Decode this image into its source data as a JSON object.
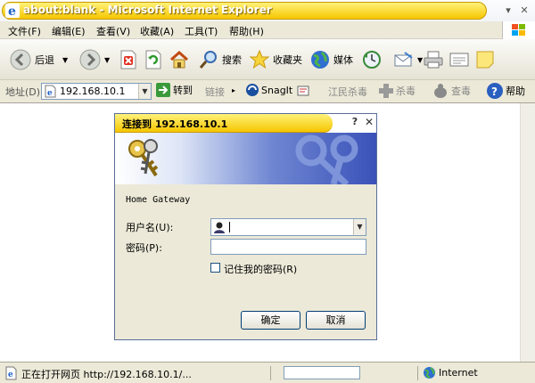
{
  "window": {
    "title": "about:blank - Microsoft Internet Explorer",
    "minimize_glyph": "▾",
    "close_glyph": "✕"
  },
  "menu": [
    "文件(F)",
    "编辑(E)",
    "查看(V)",
    "收藏(A)",
    "工具(T)",
    "帮助(H)"
  ],
  "toolbar": {
    "back_label": "后退",
    "search_label": "搜索",
    "favorites_label": "收藏夹",
    "media_label": "媒体"
  },
  "address": {
    "label": "地址(D)",
    "url": "192.168.10.1",
    "go_label": "转到",
    "links_label": "链接",
    "snagit_label": "SnagIt",
    "jiangmin_label": "江民杀毒",
    "kill_label": "杀毒",
    "scan_label": "查毒",
    "help_label": "帮助"
  },
  "dialog": {
    "title": "连接到 192.168.10.1",
    "help_glyph": "?",
    "close_glyph": "✕",
    "realm": "Home Gateway",
    "username_label": "用户名(U):",
    "password_label": "密码(P):",
    "username_value": "",
    "password_value": "",
    "remember_label": "记住我的密码(R)",
    "remember_checked": false,
    "ok_label": "确定",
    "cancel_label": "取消"
  },
  "status": {
    "text": "正在打开网页 http://192.168.10.1/...",
    "progress": 0,
    "zone": "Internet"
  },
  "colors": {
    "title_bar": "#f6c600",
    "banner_dark": "#3a52b8",
    "button_border": "#003c74"
  }
}
